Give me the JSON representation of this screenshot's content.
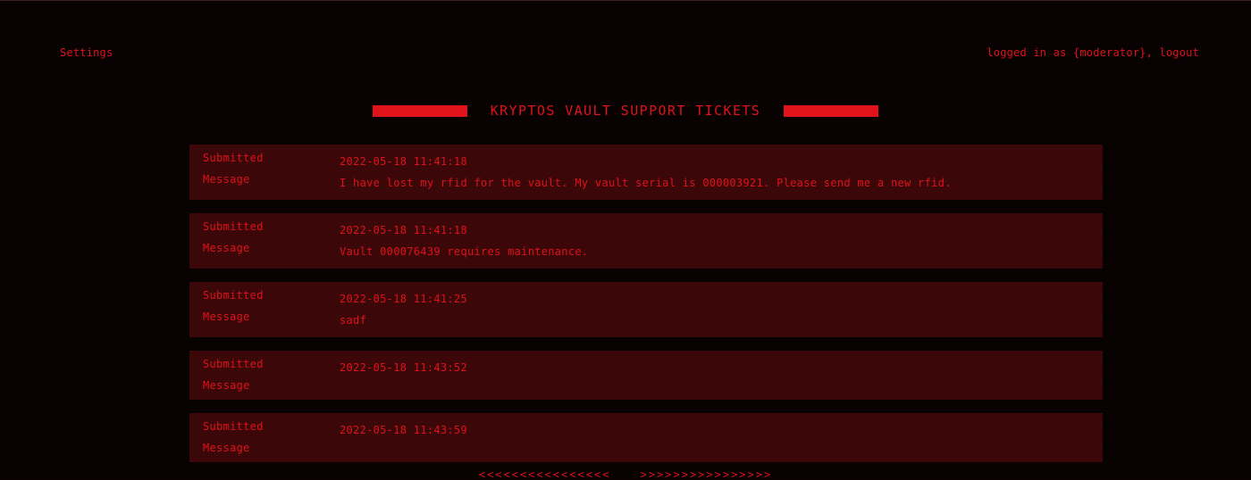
{
  "header": {
    "settings_label": "Settings",
    "user_status": "logged in as {moderator}, logout"
  },
  "title": "KRYPTOS VAULT SUPPORT TICKETS",
  "labels": {
    "submitted": "Submitted",
    "message": "Message"
  },
  "tickets": [
    {
      "submitted": "2022-05-18 11:41:18",
      "message": "I have lost my rfid for the vault. My vault serial is 000003921. Please send me a new rfid."
    },
    {
      "submitted": "2022-05-18 11:41:18",
      "message": "Vault 000076439 requires maintenance."
    },
    {
      "submitted": "2022-05-18 11:41:25",
      "message": "sadf"
    },
    {
      "submitted": "2022-05-18 11:43:52",
      "message": ""
    },
    {
      "submitted": "2022-05-18 11:43:59",
      "message": ""
    }
  ],
  "pager": {
    "prev": "<<<<<<<<<<<<<<<<",
    "next": ">>>>>>>>>>>>>>>>"
  },
  "colors": {
    "accent": "#e0121a",
    "ticket_background": "#3b0709",
    "page_background": "#060202"
  }
}
